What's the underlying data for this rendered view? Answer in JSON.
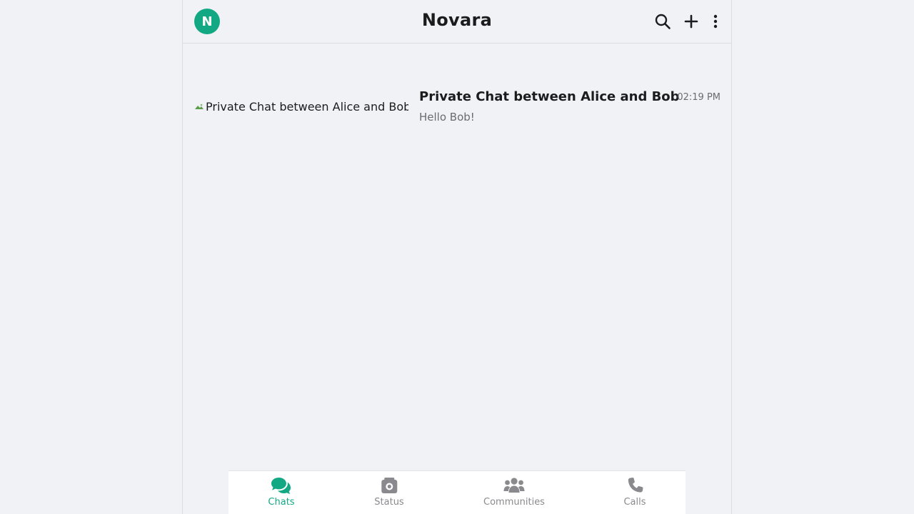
{
  "header": {
    "avatar_initial": "N",
    "title": "Novara",
    "actions": [
      {
        "name": "search-icon"
      },
      {
        "name": "plus-icon"
      },
      {
        "name": "more-vertical-icon"
      }
    ]
  },
  "chats": [
    {
      "image_alt": "Private Chat between Alice and Bob",
      "name": "Private Chat between Alice and Bob",
      "time": "02:19 PM",
      "preview": "Hello Bob!"
    }
  ],
  "bottom_nav": {
    "items": [
      {
        "label": "Chats",
        "icon": "chats-icon",
        "active": true
      },
      {
        "label": "Status",
        "icon": "status-icon",
        "active": false
      },
      {
        "label": "Communities",
        "icon": "communities-icon",
        "active": false
      },
      {
        "label": "Calls",
        "icon": "phone-icon",
        "active": false
      }
    ]
  },
  "colors": {
    "accent": "#13a884",
    "background": "#f0f2f5",
    "muted": "#8a8a8e"
  }
}
